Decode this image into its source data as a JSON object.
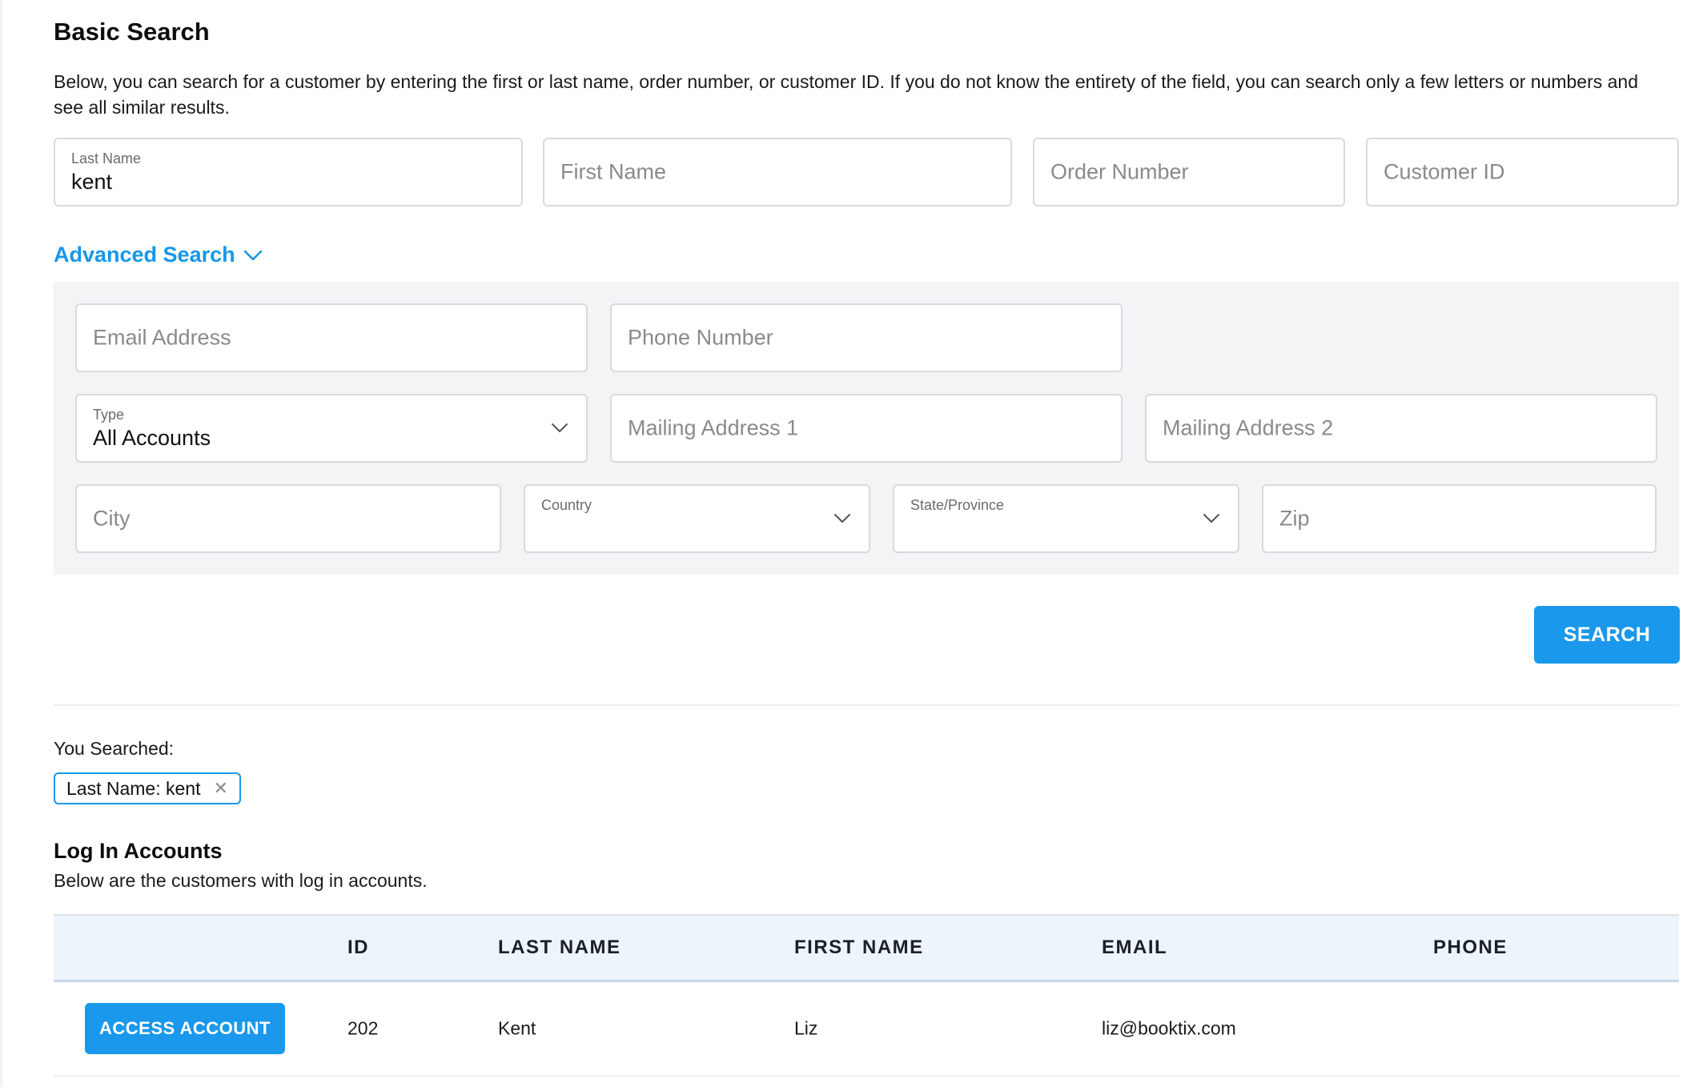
{
  "basic_search": {
    "title": "Basic Search",
    "description": "Below, you can search for a customer by entering the first or last name, order number, or customer ID. If you do not know the entirety of the field, you can search only a few letters or numbers and see all similar results.",
    "last_name": {
      "label": "Last Name",
      "value": "kent"
    },
    "first_name": {
      "placeholder": "First Name"
    },
    "order_number": {
      "placeholder": "Order Number"
    },
    "customer_id": {
      "placeholder": "Customer ID"
    }
  },
  "advanced_search": {
    "toggle_label": "Advanced Search",
    "email": {
      "placeholder": "Email Address"
    },
    "phone": {
      "placeholder": "Phone Number"
    },
    "type": {
      "label": "Type",
      "value": "All Accounts"
    },
    "mailing_address_1": {
      "placeholder": "Mailing Address 1"
    },
    "mailing_address_2": {
      "placeholder": "Mailing Address 2"
    },
    "city": {
      "placeholder": "City"
    },
    "country": {
      "label": "Country",
      "value": ""
    },
    "state_province": {
      "label": "State/Province",
      "value": ""
    },
    "zip": {
      "placeholder": "Zip"
    }
  },
  "search_button": "SEARCH",
  "you_searched": {
    "label": "You Searched:",
    "chips": [
      {
        "text": "Last Name: kent",
        "remove_icon": "close-icon"
      }
    ]
  },
  "log_in_accounts": {
    "title": "Log In Accounts",
    "description": "Below are the customers with log in accounts.",
    "columns": [
      "ID",
      "LAST NAME",
      "FIRST NAME",
      "EMAIL",
      "PHONE"
    ],
    "rows": [
      {
        "action": "ACCESS ACCOUNT",
        "id": "202",
        "last_name": "Kent",
        "first_name": "Liz",
        "email": "liz@booktix.com",
        "phone": ""
      }
    ]
  },
  "colors": {
    "accent": "#1a98ec",
    "panel_bg": "#f3f4f6",
    "table_header_bg": "#eef4fb"
  }
}
